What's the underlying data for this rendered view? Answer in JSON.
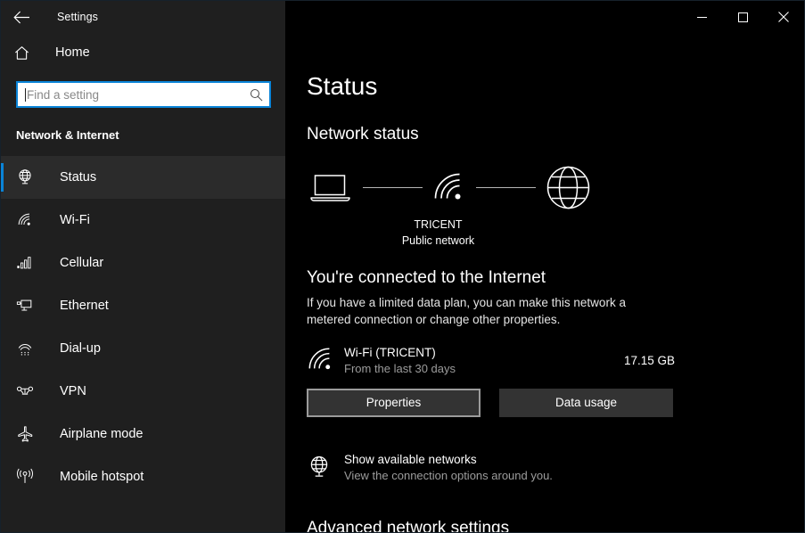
{
  "titlebar": {
    "back_icon": "back-arrow-icon",
    "title": "Settings",
    "minimize_icon": "minimize-icon",
    "maximize_icon": "maximize-icon",
    "close_icon": "close-icon"
  },
  "sidebar": {
    "home": {
      "label": "Home",
      "icon": "home-icon"
    },
    "search": {
      "value": "",
      "placeholder": "Find a setting",
      "icon": "search-icon"
    },
    "category": "Network & Internet",
    "items": [
      {
        "label": "Status",
        "icon": "network-status-icon",
        "selected": true
      },
      {
        "label": "Wi-Fi",
        "icon": "wifi-icon",
        "selected": false
      },
      {
        "label": "Cellular",
        "icon": "cellular-bars-icon",
        "selected": false
      },
      {
        "label": "Ethernet",
        "icon": "ethernet-icon",
        "selected": false
      },
      {
        "label": "Dial-up",
        "icon": "dialup-modem-icon",
        "selected": false
      },
      {
        "label": "VPN",
        "icon": "vpn-icon",
        "selected": false
      },
      {
        "label": "Airplane mode",
        "icon": "airplane-icon",
        "selected": false
      },
      {
        "label": "Mobile hotspot",
        "icon": "hotspot-icon",
        "selected": false
      }
    ]
  },
  "main": {
    "page_title": "Status",
    "section_heading": "Network status",
    "diagram": {
      "device_icon": "laptop-icon",
      "network_icon": "wifi-icon",
      "internet_icon": "globe-icon",
      "network_name": "TRICENT",
      "network_type": "Public network"
    },
    "connected_title": "You're connected to the Internet",
    "connected_description": "If you have a limited data plan, you can make this network a metered connection or change other properties.",
    "connection": {
      "icon": "wifi-icon",
      "name": "Wi-Fi (TRICENT)",
      "subtitle": "From the last 30 days",
      "data_used": "17.15 GB"
    },
    "buttons": {
      "properties": "Properties",
      "data_usage": "Data usage"
    },
    "available_networks": {
      "icon": "network-status-icon",
      "title": "Show available networks",
      "subtitle": "View the connection options around you."
    },
    "advanced_heading": "Advanced network settings"
  },
  "colors": {
    "accent": "#0a84d8",
    "sidebar_bg": "#1f1f1f",
    "content_bg": "#000000",
    "button_bg": "#333333",
    "muted_text": "#9c9c9c"
  }
}
